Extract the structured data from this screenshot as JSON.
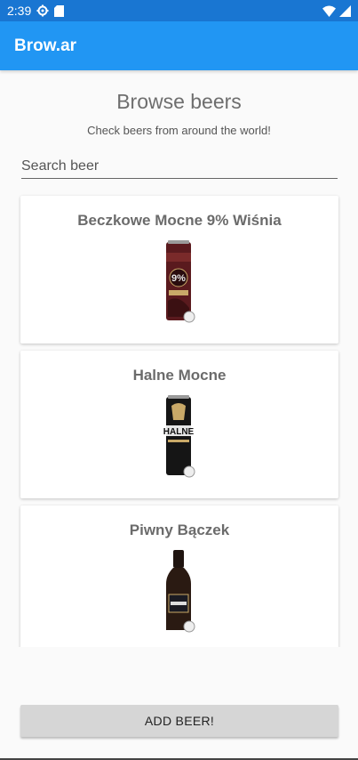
{
  "status_bar": {
    "time": "2:39",
    "icons": [
      "settings-gear-icon",
      "sd-card-icon",
      "wifi-icon",
      "cell-signal-icon"
    ]
  },
  "app_bar": {
    "title": "Brow.ar"
  },
  "header": {
    "title": "Browse beers",
    "subtitle": "Check beers from around the world!"
  },
  "search": {
    "placeholder": "Search beer",
    "value": ""
  },
  "beers": [
    {
      "name": "Beczkowe Mocne 9% Wiśnia",
      "image": "beer-can-image"
    },
    {
      "name": "Halne Mocne",
      "image": "beer-can-image"
    },
    {
      "name": "Piwny Bączek",
      "image": "beer-bottle-image"
    }
  ],
  "add_button": {
    "label": "ADD BEER!"
  },
  "colors": {
    "status_bar": "#1976d2",
    "app_bar": "#2196f3",
    "background": "#fafafa",
    "button": "#d6d6d6"
  }
}
